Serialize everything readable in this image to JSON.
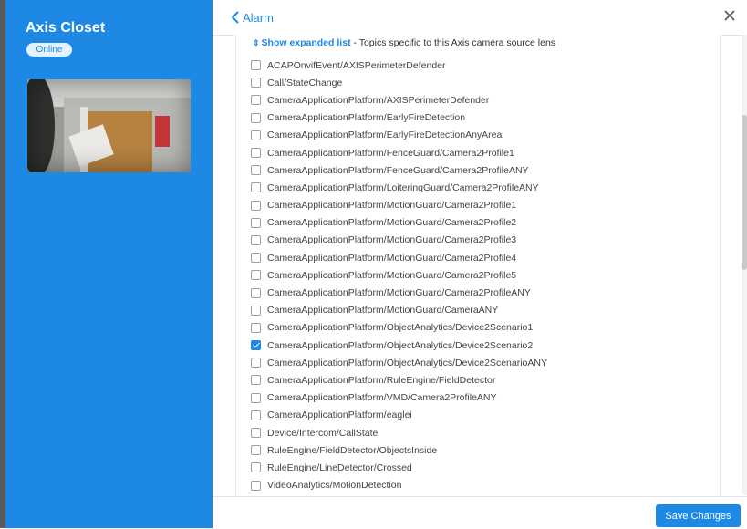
{
  "camera": {
    "name": "Axis Closet",
    "status": "Online"
  },
  "header": {
    "back_label": "Alarm",
    "back_icon": "chevron-left-icon",
    "close_icon": "close-icon"
  },
  "expanded": {
    "link_label": "Show expanded list",
    "description": " - Topics specific to this Axis camera source lens",
    "icon": "sort-arrows-icon"
  },
  "topics": [
    {
      "label": "ACAPOnvifEvent/AXISPerimeterDefender",
      "checked": false
    },
    {
      "label": "Call/StateChange",
      "checked": false
    },
    {
      "label": "CameraApplicationPlatform/AXISPerimeterDefender",
      "checked": false
    },
    {
      "label": "CameraApplicationPlatform/EarlyFireDetection",
      "checked": false
    },
    {
      "label": "CameraApplicationPlatform/EarlyFireDetectionAnyArea",
      "checked": false
    },
    {
      "label": "CameraApplicationPlatform/FenceGuard/Camera2Profile1",
      "checked": false
    },
    {
      "label": "CameraApplicationPlatform/FenceGuard/Camera2ProfileANY",
      "checked": false
    },
    {
      "label": "CameraApplicationPlatform/LoiteringGuard/Camera2ProfileANY",
      "checked": false
    },
    {
      "label": "CameraApplicationPlatform/MotionGuard/Camera2Profile1",
      "checked": false
    },
    {
      "label": "CameraApplicationPlatform/MotionGuard/Camera2Profile2",
      "checked": false
    },
    {
      "label": "CameraApplicationPlatform/MotionGuard/Camera2Profile3",
      "checked": false
    },
    {
      "label": "CameraApplicationPlatform/MotionGuard/Camera2Profile4",
      "checked": false
    },
    {
      "label": "CameraApplicationPlatform/MotionGuard/Camera2Profile5",
      "checked": false
    },
    {
      "label": "CameraApplicationPlatform/MotionGuard/Camera2ProfileANY",
      "checked": false
    },
    {
      "label": "CameraApplicationPlatform/MotionGuard/CameraANY",
      "checked": false
    },
    {
      "label": "CameraApplicationPlatform/ObjectAnalytics/Device2Scenario1",
      "checked": false
    },
    {
      "label": "CameraApplicationPlatform/ObjectAnalytics/Device2Scenario2",
      "checked": true
    },
    {
      "label": "CameraApplicationPlatform/ObjectAnalytics/Device2ScenarioANY",
      "checked": false
    },
    {
      "label": "CameraApplicationPlatform/RuleEngine/FieldDetector",
      "checked": false
    },
    {
      "label": "CameraApplicationPlatform/VMD/Camera2ProfileANY",
      "checked": false
    },
    {
      "label": "CameraApplicationPlatform/eaglei",
      "checked": false
    },
    {
      "label": "Device/Intercom/CallState",
      "checked": false
    },
    {
      "label": "RuleEngine/FieldDetector/ObjectsInside",
      "checked": false
    },
    {
      "label": "RuleEngine/LineDetector/Crossed",
      "checked": false
    },
    {
      "label": "VideoAnalytics/MotionDetection",
      "checked": false
    }
  ],
  "footer": {
    "save_label": "Save Changes"
  },
  "colors": {
    "accent": "#1e88e5",
    "status_badge_bg": "#e3f2fd"
  }
}
